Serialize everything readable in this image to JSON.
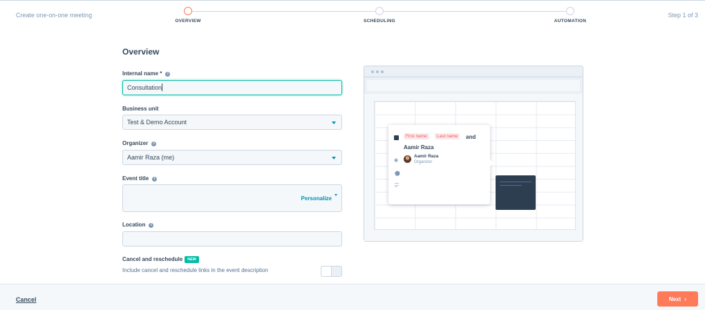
{
  "header": {
    "title": "Create one-on-one meeting",
    "step_indicator": "Step 1 of 3",
    "steps": [
      {
        "label": "OVERVIEW",
        "active": true
      },
      {
        "label": "SCHEDULING",
        "active": false
      },
      {
        "label": "AUTOMATION",
        "active": false
      }
    ]
  },
  "form": {
    "heading": "Overview",
    "internal_name": {
      "label": "Internal name *",
      "value": "Consultation"
    },
    "business_unit": {
      "label": "Business unit",
      "value": "Test & Demo Account"
    },
    "organizer": {
      "label": "Organizer",
      "value": "Aamir Raza (me)"
    },
    "event_title": {
      "label": "Event title",
      "value": "",
      "personalize_label": "Personalize"
    },
    "location": {
      "label": "Location",
      "value": ""
    },
    "cancel_reschedule": {
      "label": "Cancel and reschedule",
      "badge": "NEW",
      "description": "Include cancel and reschedule links in the event description",
      "enabled": false
    }
  },
  "preview": {
    "token_first": "First name",
    "token_last": "Last name",
    "and_text": "and",
    "attendee_name": "Aamir Raza",
    "organizer_name": "Aamir Raza",
    "organizer_role": "Organizer"
  },
  "footer": {
    "cancel_label": "Cancel",
    "next_label": "Next"
  },
  "colors": {
    "accent": "#ff7a59",
    "focus": "#00bda5",
    "link": "#0091ae",
    "dark": "#2d3e50"
  },
  "icons": {
    "info": "info-icon",
    "dropdown": "caret-down-icon",
    "next": "chevron-right-icon",
    "eye": "eye-icon",
    "location": "map-pin-icon",
    "description": "lines-icon"
  }
}
